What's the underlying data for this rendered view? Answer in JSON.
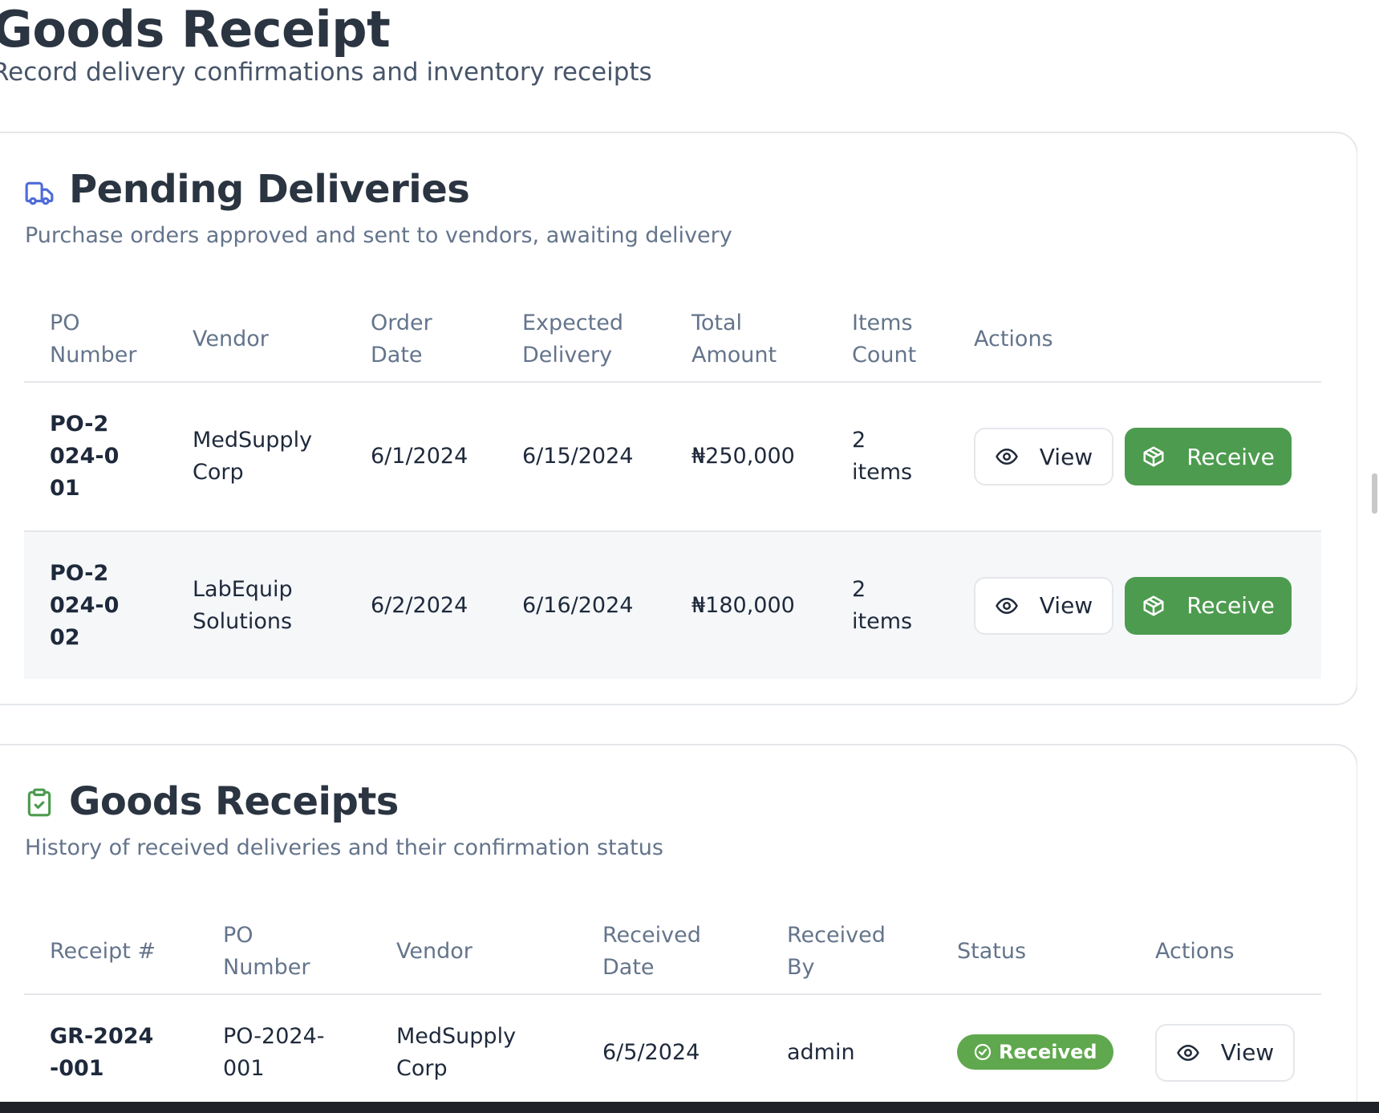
{
  "header": {
    "title": "Goods Receipt",
    "subtitle": "Record delivery confirmations and inventory receipts"
  },
  "pending": {
    "title": "Pending Deliveries",
    "description": "Purchase orders approved and sent to vendors, awaiting delivery",
    "columns": [
      "PO Number",
      "Vendor",
      "Order Date",
      "Expected Delivery",
      "Total Amount",
      "Items Count",
      "Actions"
    ],
    "rows": [
      {
        "po": "PO-2024-001",
        "vendor": "MedSupply Corp",
        "order_date": "6/1/2024",
        "expected": "6/15/2024",
        "amount": "₦250,000",
        "items": "2 items"
      },
      {
        "po": "PO-2024-002",
        "vendor": "LabEquip Solutions",
        "order_date": "6/2/2024",
        "expected": "6/16/2024",
        "amount": "₦180,000",
        "items": "2 items"
      }
    ],
    "view_label": "View",
    "receive_label": "Receive"
  },
  "receipts": {
    "title": "Goods Receipts",
    "description": "History of received deliveries and their confirmation status",
    "columns": [
      "Receipt #",
      "PO Number",
      "Vendor",
      "Received Date",
      "Received By",
      "Status",
      "Actions"
    ],
    "rows": [
      {
        "receipt": "GR-2024-001",
        "po": "PO-2024-001",
        "vendor": "MedSupply Corp",
        "received_date": "6/5/2024",
        "received_by": "admin",
        "status": "Received"
      }
    ],
    "view_label": "View"
  },
  "colors": {
    "primary_green": "#4d9b4f",
    "badge_green": "#5fa84d",
    "truck_icon_blue": "#4f6bd8",
    "clipboard_icon_green": "#4d9b4f"
  }
}
